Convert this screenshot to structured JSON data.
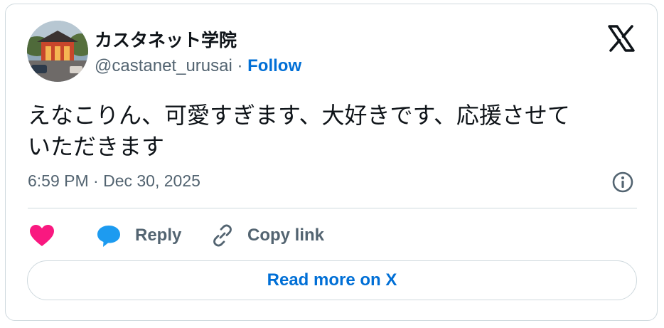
{
  "author": {
    "display_name": "カスタネット学院",
    "handle": "@castanet_urusai",
    "separator": " · ",
    "follow_label": "Follow",
    "avatar_icon": "avatar-photo"
  },
  "tweet": {
    "text_line1": "えなこりん、可愛すぎます、大好きです、応援させて",
    "text_line2": "いただきます",
    "timestamp": "6:59 PM · Dec 30, 2025"
  },
  "actions": {
    "like_icon": "heart-icon",
    "reply_label": "Reply",
    "copy_link_label": "Copy link"
  },
  "footer": {
    "read_more_label": "Read more on X"
  },
  "colors": {
    "text_primary": "#0f1419",
    "text_secondary": "#536471",
    "link_blue": "#006fd6",
    "like_red": "#f91880",
    "reply_blue": "#1d9bf0",
    "border": "#cfd9de"
  }
}
